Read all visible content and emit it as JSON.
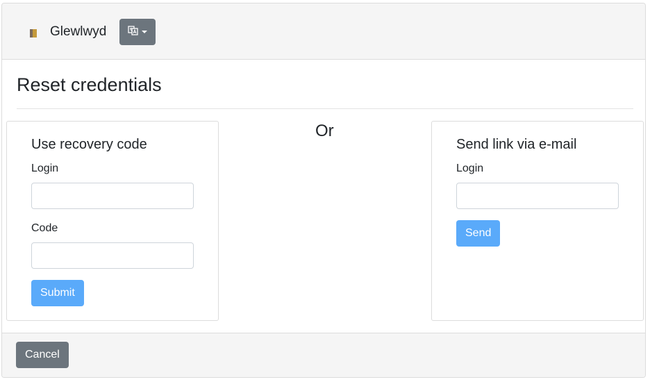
{
  "header": {
    "brand_icon": "door-icon",
    "brand_name": "Glewlwyd",
    "language_button_icon": "language-icon"
  },
  "page": {
    "title": "Reset credentials",
    "separator": "Or"
  },
  "recovery_code": {
    "title": "Use recovery code",
    "login_label": "Login",
    "login_value": "",
    "code_label": "Code",
    "code_value": "",
    "submit_label": "Submit"
  },
  "email_link": {
    "title": "Send link via e-mail",
    "login_label": "Login",
    "login_value": "",
    "send_label": "Send"
  },
  "footer": {
    "cancel_label": "Cancel"
  },
  "colors": {
    "primary": "#5aaafa",
    "secondary": "#6c757d",
    "header_bg": "#f5f5f5"
  }
}
